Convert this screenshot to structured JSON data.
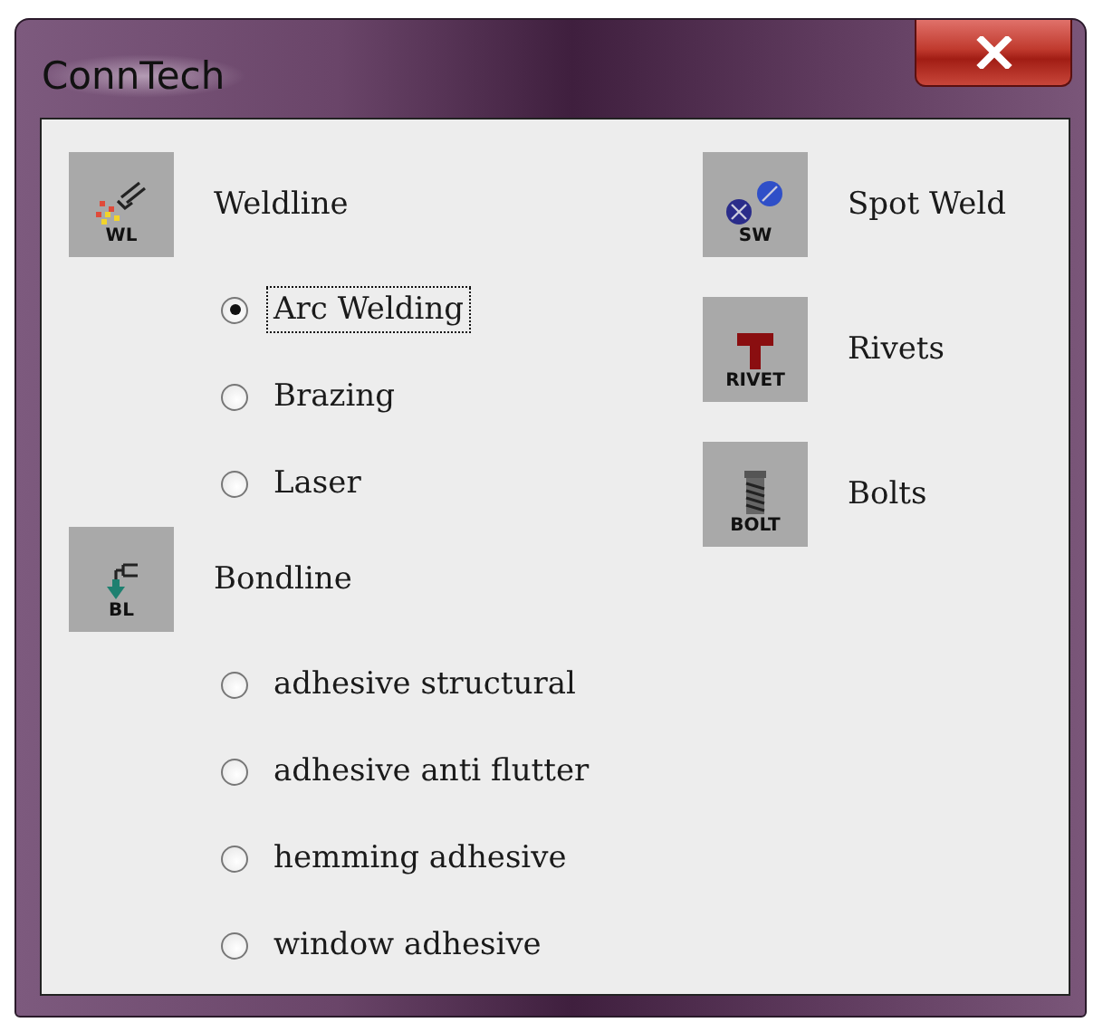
{
  "window": {
    "title": "ConnTech"
  },
  "groups": [
    {
      "label": "Weldline",
      "icon": {
        "kind": "weldline",
        "text": "WL"
      },
      "options": [
        {
          "label": "Arc Welding",
          "selected": true,
          "focused": true
        },
        {
          "label": "Brazing",
          "selected": false,
          "focused": false
        },
        {
          "label": "Laser",
          "selected": false,
          "focused": false
        }
      ]
    },
    {
      "label": "Bondline",
      "icon": {
        "kind": "bondline",
        "text": "BL"
      },
      "options": [
        {
          "label": "adhesive structural",
          "selected": false,
          "focused": false
        },
        {
          "label": "adhesive anti flutter",
          "selected": false,
          "focused": false
        },
        {
          "label": "hemming adhesive",
          "selected": false,
          "focused": false
        },
        {
          "label": "window adhesive",
          "selected": false,
          "focused": false
        }
      ]
    }
  ],
  "tools": [
    {
      "label": "Spot Weld",
      "icon": {
        "kind": "spotweld",
        "text": "SW"
      }
    },
    {
      "label": "Rivets",
      "icon": {
        "kind": "rivet",
        "text": "RIVET"
      }
    },
    {
      "label": "Bolts",
      "icon": {
        "kind": "bolt",
        "text": "BOLT"
      }
    }
  ]
}
